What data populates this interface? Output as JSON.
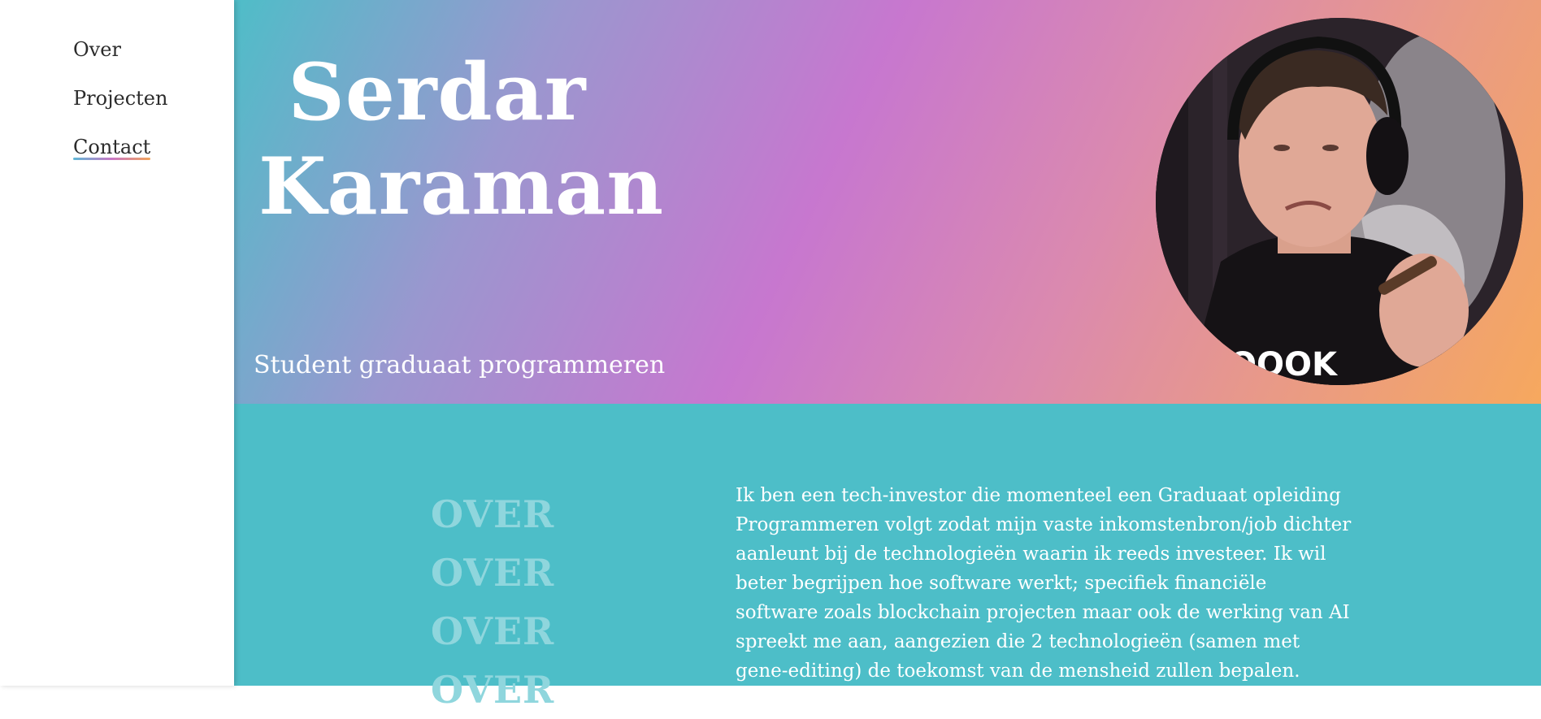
{
  "nav": {
    "items": [
      {
        "label": "Over"
      },
      {
        "label": "Projecten"
      },
      {
        "label": "Contact"
      }
    ]
  },
  "hero": {
    "title_line1": "Serdar",
    "title_line2": "Karaman",
    "subtitle": "Student graduaat programmeren"
  },
  "over": {
    "headings": [
      "OVER",
      "OVER",
      "OVER",
      "OVER"
    ],
    "text": "Ik ben een tech-investor die momenteel een Graduaat opleiding Programmeren volgt zodat mijn vaste inkomstenbron/job dichter aanleunt bij de technologieën waarin ik reeds investeer. Ik wil beter begrijpen hoe software werkt; specifiek financiële software zoals blockchain projecten maar ook de werking van AI spreekt me aan, aangezien die 2 technologieën (samen met gene-editing) de toekomst van de mensheid zullen bepalen."
  },
  "colors": {
    "teal": "#4dbec8",
    "purple": "#c777cf",
    "orange": "#f6a85e"
  }
}
